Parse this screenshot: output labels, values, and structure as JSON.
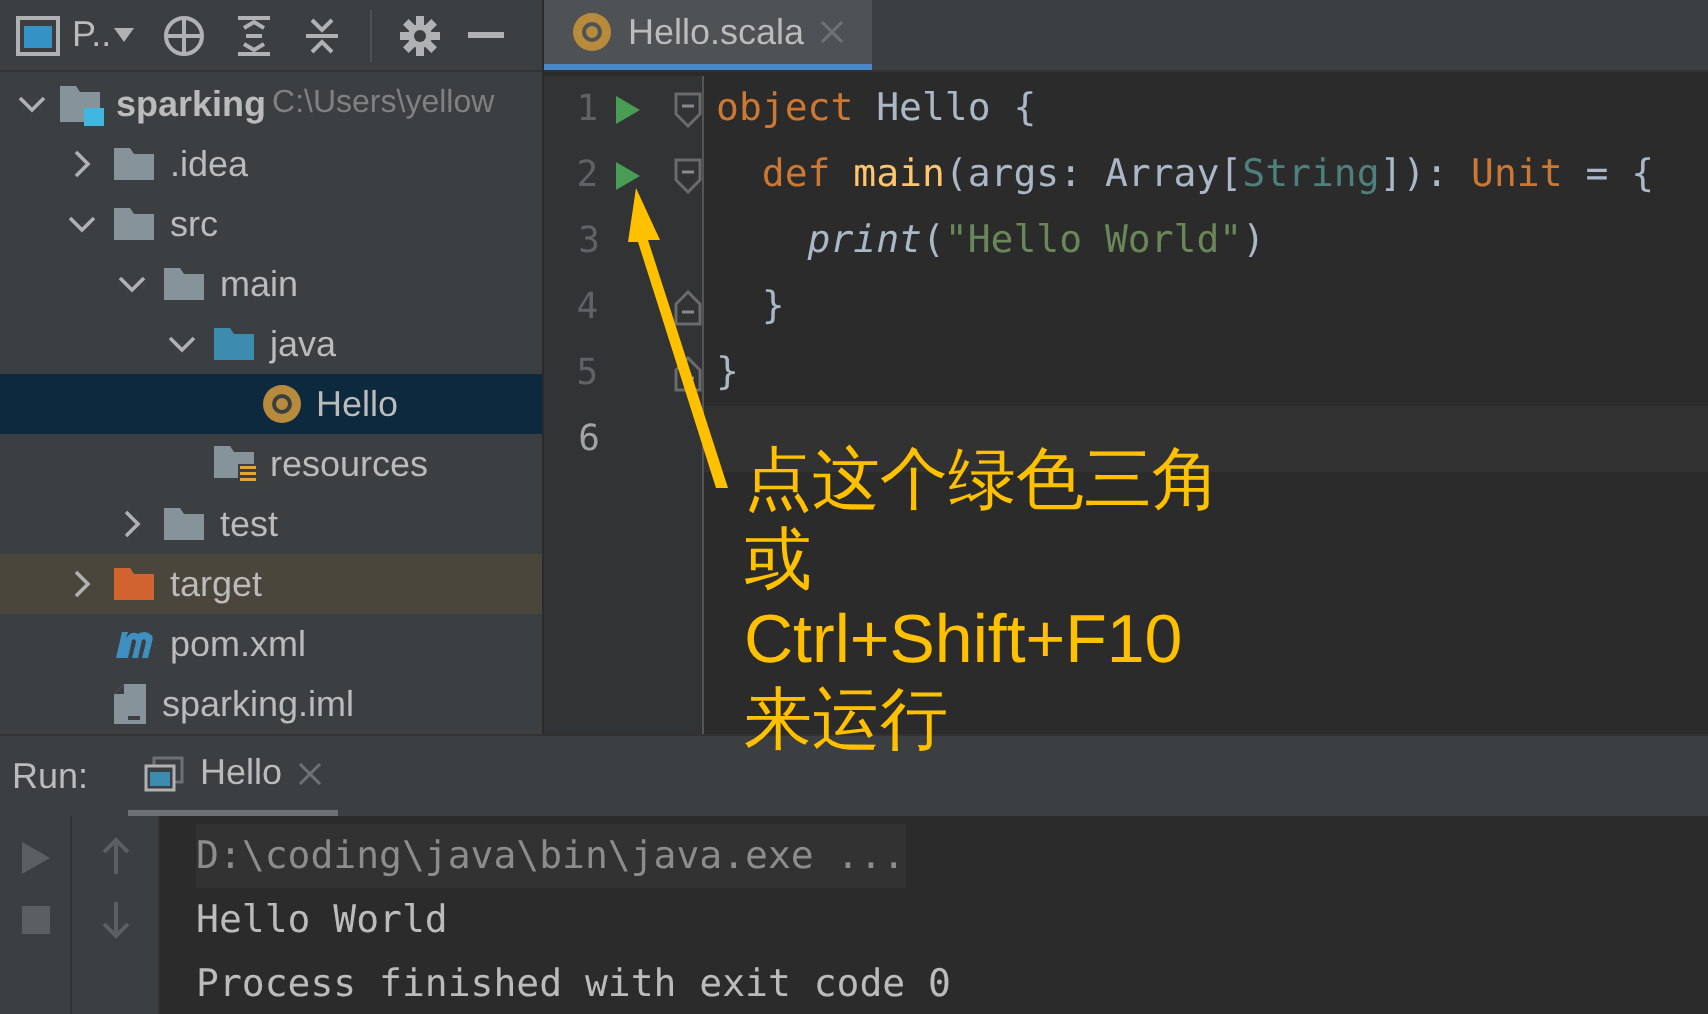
{
  "toolbar": {
    "view_label": "P.."
  },
  "project_tree": [
    {
      "name": "sparking",
      "path": "C:\\Users\\yellow",
      "kind": "module",
      "expanded": true,
      "selected": false,
      "children": [
        {
          "name": ".idea",
          "kind": "folder",
          "expanded": false,
          "selected": false
        },
        {
          "name": "src",
          "kind": "folder",
          "expanded": true,
          "selected": false,
          "children": [
            {
              "name": "main",
              "kind": "folder",
              "expanded": true,
              "selected": false,
              "children": [
                {
                  "name": "java",
                  "kind": "source-folder",
                  "expanded": true,
                  "selected": false,
                  "children": [
                    {
                      "name": "Hello",
                      "kind": "scala-object",
                      "selected": true
                    }
                  ]
                },
                {
                  "name": "resources",
                  "kind": "resources-folder",
                  "selected": false
                }
              ]
            },
            {
              "name": "test",
              "kind": "folder",
              "expanded": false,
              "selected": false
            }
          ]
        },
        {
          "name": "target",
          "kind": "excluded-folder",
          "expanded": false,
          "selected": false
        },
        {
          "name": "pom.xml",
          "kind": "maven",
          "selected": false
        },
        {
          "name": "sparking.iml",
          "kind": "iml",
          "selected": false
        }
      ]
    }
  ],
  "editor": {
    "tabs": [
      {
        "label": "Hello.scala",
        "selected": true
      }
    ],
    "lines": [
      {
        "number": "1",
        "run": true,
        "kind": "fold-start",
        "current": false,
        "tokens": [
          {
            "kind": "keyword",
            "text": "object"
          },
          {
            "kind": "plain",
            "text": " Hello {"
          }
        ]
      },
      {
        "number": "2",
        "run": true,
        "kind": "fold-start",
        "current": false,
        "tokens": [
          {
            "kind": "keyword",
            "text": "  def"
          },
          {
            "kind": "function",
            "text": " main"
          },
          {
            "kind": "plain",
            "text": "(args: Array["
          },
          {
            "kind": "type",
            "text": "String"
          },
          {
            "kind": "plain",
            "text": "]): "
          },
          {
            "kind": "keyword",
            "text": "Unit"
          },
          {
            "kind": "plain",
            "text": " = {"
          }
        ]
      },
      {
        "number": "3",
        "run": false,
        "kind": "plain",
        "current": false,
        "tokens": [
          {
            "kind": "call",
            "text": "    print"
          },
          {
            "kind": "plain",
            "text": "("
          },
          {
            "kind": "string",
            "text": "\"Hello World\""
          },
          {
            "kind": "plain",
            "text": ")"
          }
        ]
      },
      {
        "number": "4",
        "run": false,
        "kind": "fold-end",
        "current": false,
        "tokens": [
          {
            "kind": "plain",
            "text": "  }"
          }
        ]
      },
      {
        "number": "5",
        "run": false,
        "kind": "fold-end",
        "current": false,
        "tokens": [
          {
            "kind": "plain",
            "text": "}"
          }
        ]
      },
      {
        "number": "6",
        "run": false,
        "kind": "plain",
        "current": true
      }
    ]
  },
  "annotation": {
    "lines": [
      "点这个绿色三角",
      "或",
      "Ctrl+Shift+F10",
      "来运行"
    ]
  },
  "run_panel": {
    "label": "Run:",
    "tabs": [
      {
        "label": "Hello",
        "selected": true
      }
    ],
    "console": [
      {
        "kind": "command",
        "text": "D:\\coding\\java\\bin\\java.exe ..."
      },
      {
        "kind": "output",
        "text": "Hello World"
      },
      {
        "kind": "output",
        "text": "Process finished with exit code 0"
      }
    ]
  }
}
